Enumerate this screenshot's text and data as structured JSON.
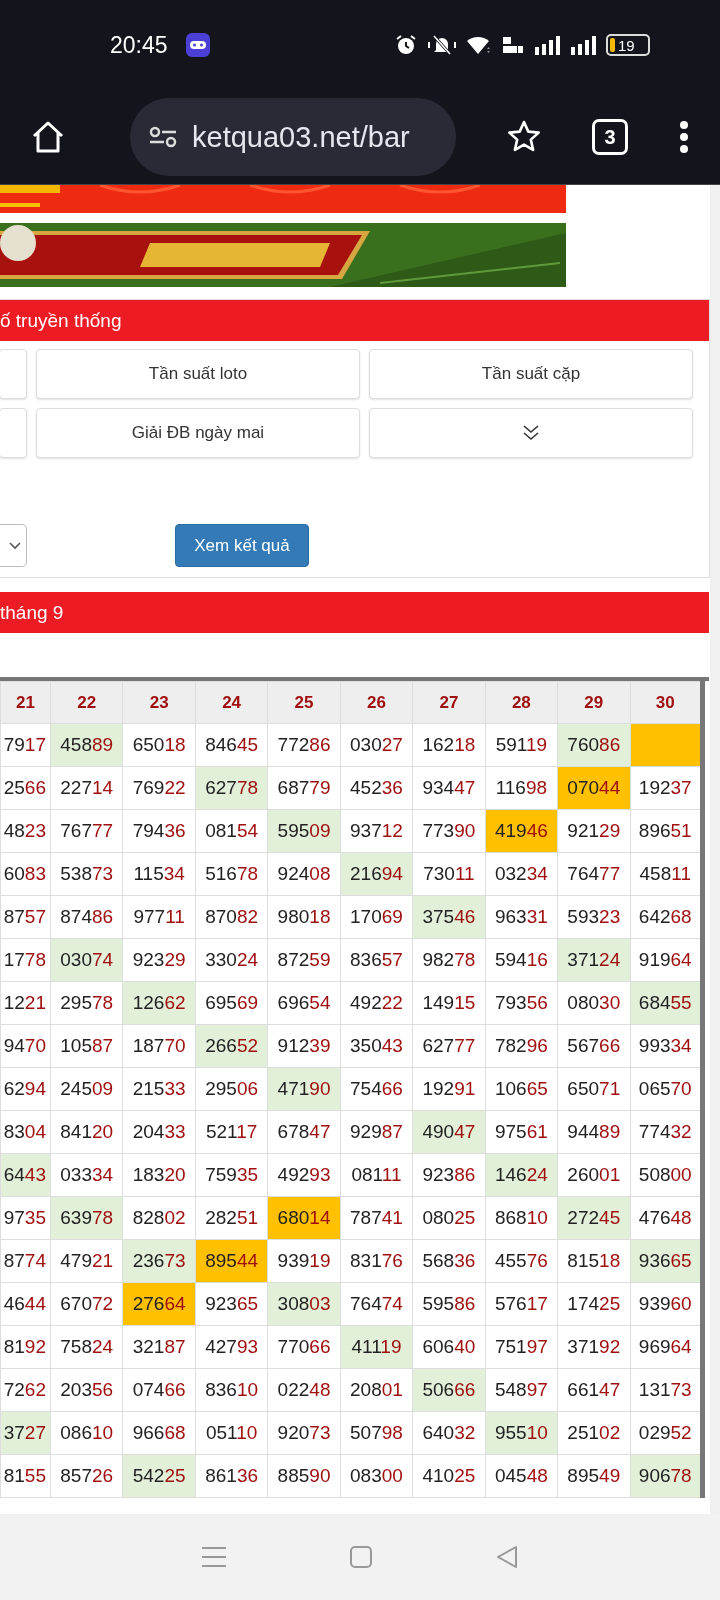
{
  "status_bar": {
    "time": "20:45",
    "battery": "19"
  },
  "browser": {
    "url": "ketqua03.net/bar",
    "tab_count": "3"
  },
  "tools_panel": {
    "title": "ố truyền thống",
    "buttons": [
      {
        "kind": "blank"
      },
      {
        "kind": "text",
        "label": "Tần suất loto"
      },
      {
        "kind": "text",
        "label": "Tần suất cặp"
      },
      {
        "kind": "blank"
      },
      {
        "kind": "text",
        "label": "Giải ĐB ngày mai"
      },
      {
        "kind": "expand"
      }
    ],
    "submit": "Xem kết quả"
  },
  "results_panel": {
    "title": "tháng 9",
    "table": {
      "columns": [
        "21",
        "22",
        "23",
        "24",
        "25",
        "26",
        "27",
        "28",
        "29",
        "30"
      ],
      "rows": [
        [
          {
            "text": "7917"
          },
          {
            "text": "45889",
            "color": "#e2f0d9"
          },
          {
            "text": "65018"
          },
          {
            "text": "84645"
          },
          {
            "text": "77286"
          },
          {
            "text": "03027"
          },
          {
            "text": "16218"
          },
          {
            "text": "59119"
          },
          {
            "text": "76086",
            "color": "#e2f0d9"
          },
          {
            "color": "#ffc000"
          }
        ],
        [
          {
            "text": "2566"
          },
          {
            "text": "22714"
          },
          {
            "text": "76922"
          },
          {
            "text": "62778",
            "color": "#e2f0d9"
          },
          {
            "text": "68779"
          },
          {
            "text": "45236"
          },
          {
            "text": "93447"
          },
          {
            "text": "11698"
          },
          {
            "text": "07044",
            "color": "#ffc000"
          },
          {
            "text": "19237"
          }
        ],
        [
          {
            "text": "4823"
          },
          {
            "text": "76777"
          },
          {
            "text": "79436"
          },
          {
            "text": "08154"
          },
          {
            "text": "59509",
            "color": "#e2f0d9"
          },
          {
            "text": "93712"
          },
          {
            "text": "77390"
          },
          {
            "text": "41946",
            "color": "#ffc000"
          },
          {
            "text": "92129"
          },
          {
            "text": "89651"
          }
        ],
        [
          {
            "text": "6083"
          },
          {
            "text": "53873"
          },
          {
            "text": "11534"
          },
          {
            "text": "51678"
          },
          {
            "text": "92408"
          },
          {
            "text": "21694",
            "color": "#e2f0d9"
          },
          {
            "text": "73011"
          },
          {
            "text": "03234"
          },
          {
            "text": "76477"
          },
          {
            "text": "45811"
          }
        ],
        [
          {
            "text": "8757"
          },
          {
            "text": "87486"
          },
          {
            "text": "97711"
          },
          {
            "text": "87082"
          },
          {
            "text": "98018"
          },
          {
            "text": "17069"
          },
          {
            "text": "37546",
            "color": "#e2f0d9"
          },
          {
            "text": "96331"
          },
          {
            "text": "59323"
          },
          {
            "text": "64268"
          }
        ],
        [
          {
            "text": "1778"
          },
          {
            "text": "03074",
            "color": "#e2f0d9"
          },
          {
            "text": "92329"
          },
          {
            "text": "33024"
          },
          {
            "text": "87259"
          },
          {
            "text": "83657"
          },
          {
            "text": "98278"
          },
          {
            "text": "59416"
          },
          {
            "text": "37124",
            "color": "#e2f0d9"
          },
          {
            "text": "91964"
          }
        ],
        [
          {
            "text": "1221"
          },
          {
            "text": "29578"
          },
          {
            "text": "12662",
            "color": "#e2f0d9"
          },
          {
            "text": "69569"
          },
          {
            "text": "69654"
          },
          {
            "text": "49222"
          },
          {
            "text": "14915"
          },
          {
            "text": "79356"
          },
          {
            "text": "08030"
          },
          {
            "text": "68455",
            "color": "#e2f0d9"
          }
        ],
        [
          {
            "text": "9470"
          },
          {
            "text": "10587"
          },
          {
            "text": "18770"
          },
          {
            "text": "26652",
            "color": "#e2f0d9"
          },
          {
            "text": "91239"
          },
          {
            "text": "35043"
          },
          {
            "text": "62777"
          },
          {
            "text": "78296"
          },
          {
            "text": "56766"
          },
          {
            "text": "99334"
          }
        ],
        [
          {
            "text": "6294"
          },
          {
            "text": "24509"
          },
          {
            "text": "21533"
          },
          {
            "text": "29506"
          },
          {
            "text": "47190",
            "color": "#e2f0d9"
          },
          {
            "text": "75466"
          },
          {
            "text": "19291"
          },
          {
            "text": "10665"
          },
          {
            "text": "65071"
          },
          {
            "text": "06570"
          }
        ],
        [
          {
            "text": "8304"
          },
          {
            "text": "84120"
          },
          {
            "text": "20433"
          },
          {
            "text": "52117"
          },
          {
            "text": "67847"
          },
          {
            "text": "92987"
          },
          {
            "text": "49047",
            "color": "#e2f0d9"
          },
          {
            "text": "97561"
          },
          {
            "text": "94489"
          },
          {
            "text": "77432"
          }
        ],
        [
          {
            "text": "6443",
            "color": "#e2f0d9"
          },
          {
            "text": "03334"
          },
          {
            "text": "18320"
          },
          {
            "text": "75935"
          },
          {
            "text": "49293"
          },
          {
            "text": "08111"
          },
          {
            "text": "92386"
          },
          {
            "text": "14624",
            "color": "#e2f0d9"
          },
          {
            "text": "26001"
          },
          {
            "text": "50800"
          }
        ],
        [
          {
            "text": "9735"
          },
          {
            "text": "63978",
            "color": "#e2f0d9"
          },
          {
            "text": "82802"
          },
          {
            "text": "28251"
          },
          {
            "text": "68014",
            "color": "#ffc000"
          },
          {
            "text": "78741"
          },
          {
            "text": "08025"
          },
          {
            "text": "86810"
          },
          {
            "text": "27245",
            "color": "#e2f0d9"
          },
          {
            "text": "47648"
          }
        ],
        [
          {
            "text": "8774"
          },
          {
            "text": "47921"
          },
          {
            "text": "23673",
            "color": "#e2f0d9"
          },
          {
            "text": "89544",
            "color": "#ffc000"
          },
          {
            "text": "93919"
          },
          {
            "text": "83176"
          },
          {
            "text": "56836"
          },
          {
            "text": "45576"
          },
          {
            "text": "81518"
          },
          {
            "text": "93665",
            "color": "#e2f0d9"
          }
        ],
        [
          {
            "text": "4644"
          },
          {
            "text": "67072"
          },
          {
            "text": "27664",
            "color": "#ffc000"
          },
          {
            "text": "92365"
          },
          {
            "text": "30803",
            "color": "#e2f0d9"
          },
          {
            "text": "76474"
          },
          {
            "text": "59586"
          },
          {
            "text": "57617"
          },
          {
            "text": "17425"
          },
          {
            "text": "93960"
          }
        ],
        [
          {
            "text": "8192"
          },
          {
            "text": "75824"
          },
          {
            "text": "32187"
          },
          {
            "text": "42793"
          },
          {
            "text": "77066"
          },
          {
            "text": "41119",
            "color": "#e2f0d9"
          },
          {
            "text": "60640"
          },
          {
            "text": "75197"
          },
          {
            "text": "37192"
          },
          {
            "text": "96964"
          }
        ],
        [
          {
            "text": "7262"
          },
          {
            "text": "20356"
          },
          {
            "text": "07466"
          },
          {
            "text": "83610"
          },
          {
            "text": "02248"
          },
          {
            "text": "20801"
          },
          {
            "text": "50666",
            "color": "#e2f0d9"
          },
          {
            "text": "54897"
          },
          {
            "text": "66147"
          },
          {
            "text": "13173"
          }
        ],
        [
          {
            "text": "3727",
            "color": "#e2f0d9"
          },
          {
            "text": "08610"
          },
          {
            "text": "96668"
          },
          {
            "text": "05110"
          },
          {
            "text": "92073"
          },
          {
            "text": "50798"
          },
          {
            "text": "64032"
          },
          {
            "text": "95510",
            "color": "#e2f0d9"
          },
          {
            "text": "25102"
          },
          {
            "text": "02952"
          }
        ],
        [
          {
            "text": "8155"
          },
          {
            "text": "85726"
          },
          {
            "text": "54225",
            "color": "#e2f0d9"
          },
          {
            "text": "86136"
          },
          {
            "text": "88590"
          },
          {
            "text": "08300"
          },
          {
            "text": "41025"
          },
          {
            "text": "04548"
          },
          {
            "text": "89549"
          },
          {
            "text": "90678",
            "color": "#e2f0d9"
          }
        ]
      ]
    }
  }
}
